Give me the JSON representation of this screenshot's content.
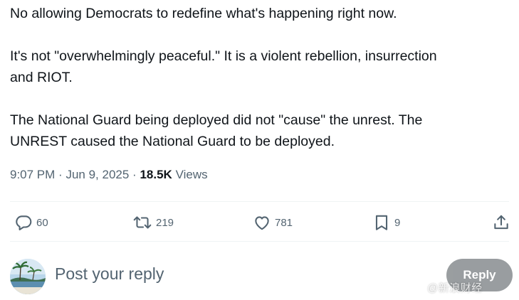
{
  "tweet": {
    "paragraphs": [
      "No allowing Democrats to redefine what's happening right now.",
      "It's not \"overwhelmingly peaceful.\" It is a violent rebellion, insurrection",
      "and RIOT.",
      "The National Guard being deployed did not \"cause\" the unrest. The",
      "UNREST caused the National Guard to be deployed."
    ],
    "time": "9:07 PM",
    "separator": "·",
    "date": "Jun 9, 2025",
    "views_count": "18.5K",
    "views_label": "Views"
  },
  "actions": {
    "replies": {
      "icon": "comment-icon",
      "count": "60"
    },
    "retweets": {
      "icon": "retweet-icon",
      "count": "219"
    },
    "likes": {
      "icon": "heart-icon",
      "count": "781"
    },
    "bookmarks": {
      "icon": "bookmark-icon",
      "count": "9"
    },
    "share": {
      "icon": "share-icon"
    }
  },
  "reply_composer": {
    "placeholder": "Post your reply",
    "button_label": "Reply"
  },
  "watermark": "@新浪财经",
  "colors": {
    "text_primary": "#0f1419",
    "text_secondary": "#536471",
    "divider": "#eff3f4",
    "reply_button_disabled": "#8f9396"
  }
}
